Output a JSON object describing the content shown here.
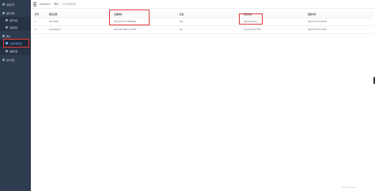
{
  "sidebar": {
    "items": [
      {
        "label": "系统首页"
      },
      {
        "label": "服务管理"
      },
      {
        "label": "服务列表"
      },
      {
        "label": "添加服务"
      },
      {
        "label": "网关"
      },
      {
        "label": "负载均衡配置"
      },
      {
        "label": "熔断配置"
      },
      {
        "label": "租户管理"
      }
    ]
  },
  "breadcrumb": {
    "items": [
      "Dashboard",
      "网关",
      "负载均衡配置"
    ]
  },
  "table": {
    "headers": [
      "序号",
      "服务名称",
      "后端地址",
      "协议",
      "转发地址",
      "更新时间"
    ],
    "rows": [
      [
        "1",
        "DemoHttp",
        "http://127.0.0.1:8080/api",
        "http",
        "http://localhost",
        "2021-07-01 10:00:00"
      ],
      [
        "2",
        "serviceDemo",
        "http://192.168.0.10:7070",
        "tcp",
        "tcp://10.0.0.5:7070",
        "2021-07-02 11:30:00"
      ]
    ]
  },
  "footer": {
    "text": "CSDN @gateway"
  }
}
